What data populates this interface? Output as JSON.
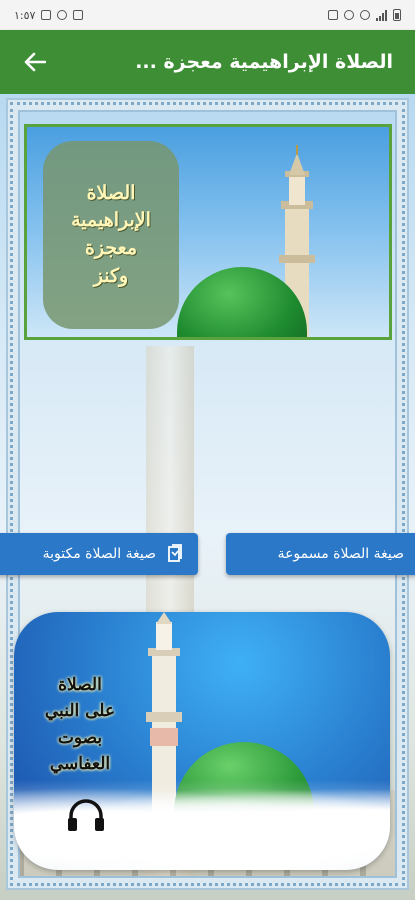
{
  "status_bar": {
    "time": "١:٥٧"
  },
  "app_bar": {
    "title": "الصلاة الإبراهيمية معجزة ..."
  },
  "banner": {
    "text": "الصلاة\nالإبراهيمية\nمعجزة\nوكنز"
  },
  "buttons": {
    "audio_label": "صيغة الصلاة مسموعة",
    "written_label": "صيغة الصلاة مكتوبة"
  },
  "audio_card": {
    "text": "الصلاة\nعلى النبي\nبصوت\nالعفاسي"
  },
  "colors": {
    "app_bar": "#3e8e35",
    "button": "#2b78c8",
    "banner_border": "#5aa23c"
  },
  "icons": {
    "back": "arrow-left-icon",
    "document": "document-icon",
    "headphones": "headphones-icon"
  }
}
